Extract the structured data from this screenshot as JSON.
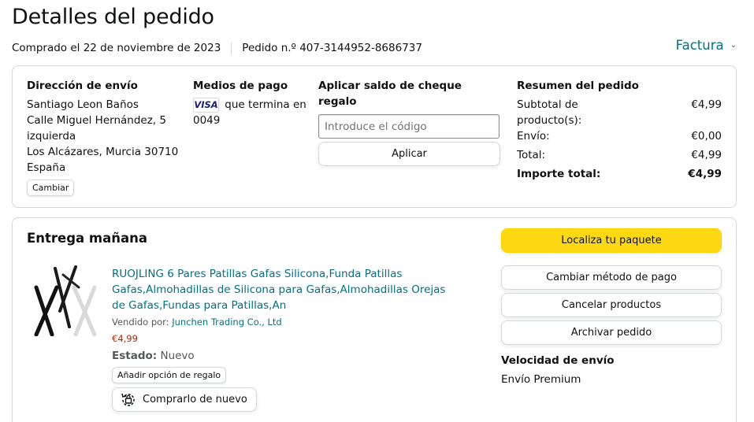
{
  "page": {
    "title": "Detalles del pedido",
    "purchase_date": "Comprado el 22 de noviembre de 2023",
    "order_number": "Pedido n.º 407-3144952-8686737",
    "invoice_label": "Factura"
  },
  "shipping": {
    "heading": "Dirección de envío",
    "lines": [
      "Santiago Leon Baños",
      "Calle Miguel Hernández, 5",
      "izquierda",
      "Los Alcázares, Murcia 30710",
      "España"
    ],
    "change_label": "Cambiar"
  },
  "payment": {
    "heading": "Medios de pago",
    "card_brand": "VISA",
    "ending_text": "que termina en",
    "last_digits": "0049"
  },
  "gift_card": {
    "heading": "Aplicar saldo de cheque regalo",
    "placeholder": "Introduce el código",
    "apply_label": "Aplicar"
  },
  "summary": {
    "heading": "Resumen del pedido",
    "rows": [
      {
        "label": "Subtotal de producto(s):",
        "value": "€4,99"
      },
      {
        "label": "Envío:",
        "value": "€0,00"
      },
      {
        "label": "Total:",
        "value": "€4,99"
      },
      {
        "label": "Importe total:",
        "value": "€4,99"
      }
    ]
  },
  "delivery": {
    "heading": "Entrega mañana",
    "product": {
      "title": "RUOJLING 6 Pares Patillas Gafas Silicona,Funda Patillas Gafas,Almohadillas de Silicona para Gafas,Almohadillas Orejas de Gafas,Fundas para Patillas,An",
      "seller_prefix": "Vendido por:",
      "seller_name": "Junchen Trading Co., Ltd",
      "price": "€4,99",
      "state_label": "Estado:",
      "state_value": "Nuevo",
      "gift_option_label": "Añadir opción de regalo",
      "buy_again_label": "Comprarlo de nuevo"
    },
    "actions": {
      "track": "Localiza tu paquete",
      "change_payment": "Cambiar método de pago",
      "cancel": "Cancelar productos",
      "archive": "Archivar pedido"
    },
    "speed_heading": "Velocidad de envío",
    "speed_value": "Envío Premium"
  },
  "colors": {
    "link": "#007185",
    "price": "#b12704",
    "primary_button": "#ffd814",
    "border": "#d5d9d9"
  }
}
